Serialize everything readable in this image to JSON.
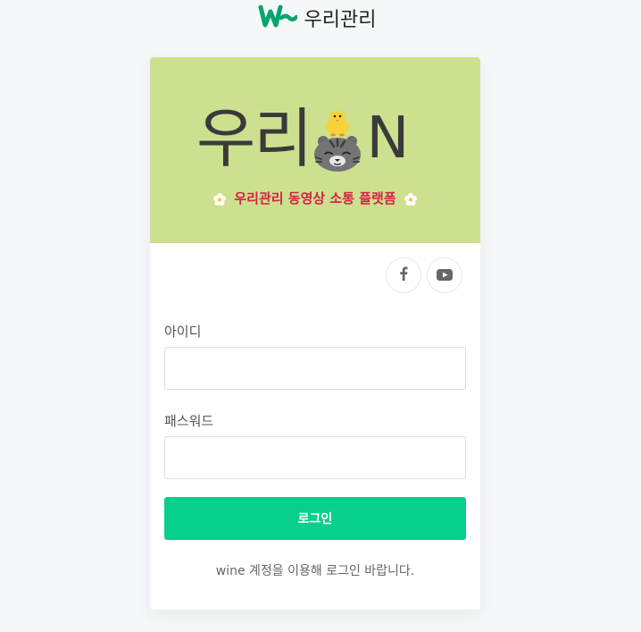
{
  "header": {
    "brand": "우리관리"
  },
  "hero": {
    "title_left": "우리",
    "title_right": "N",
    "subtitle": "우리관리 동영상 소통 플랫폼"
  },
  "social": [
    {
      "name": "facebook",
      "icon": "facebook-icon"
    },
    {
      "name": "youtube",
      "icon": "youtube-icon"
    }
  ],
  "form": {
    "id_label": "아이디",
    "id_value": "",
    "password_label": "패스워드",
    "password_value": "",
    "login_label": "로그인",
    "note": "wine 계정을 이용해 로그인 바랍니다."
  },
  "colors": {
    "accent": "#06d08b",
    "hero_bg": "#cde08f",
    "subtitle": "#d61f45",
    "background": "#f5f7fb"
  }
}
